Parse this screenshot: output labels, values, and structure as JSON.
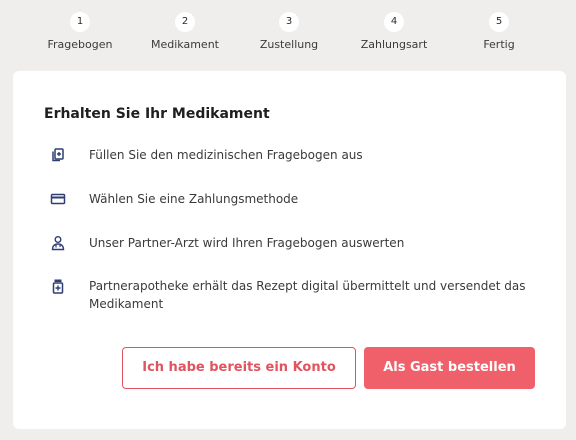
{
  "stepper": {
    "steps": [
      {
        "number": "1",
        "label": "Fragebogen"
      },
      {
        "number": "2",
        "label": "Medikament"
      },
      {
        "number": "3",
        "label": "Zustellung"
      },
      {
        "number": "4",
        "label": "Zahlungsart"
      },
      {
        "number": "5",
        "label": "Fertig"
      }
    ]
  },
  "card": {
    "title": "Erhalten Sie Ihr Medikament",
    "items": [
      {
        "icon": "questionnaire-icon",
        "text": "Füllen Sie den medizinischen Fragebogen aus"
      },
      {
        "icon": "credit-card-icon",
        "text": "Wählen Sie eine Zahlungsmethode"
      },
      {
        "icon": "doctor-icon",
        "text": "Unser Partner-Arzt wird Ihren Fragebogen auswerten"
      },
      {
        "icon": "medicine-bottle-icon",
        "text": "Partnerapotheke erhält das Rezept digital übermittelt und versendet das Medikament"
      }
    ]
  },
  "buttons": {
    "login_label": "Ich habe bereits ein Konto",
    "guest_label": "Als Gast bestellen"
  },
  "colors": {
    "accent": "#f0606b",
    "outline": "#e1545f",
    "background": "#f0eeed",
    "icon": "#2f3e73"
  }
}
